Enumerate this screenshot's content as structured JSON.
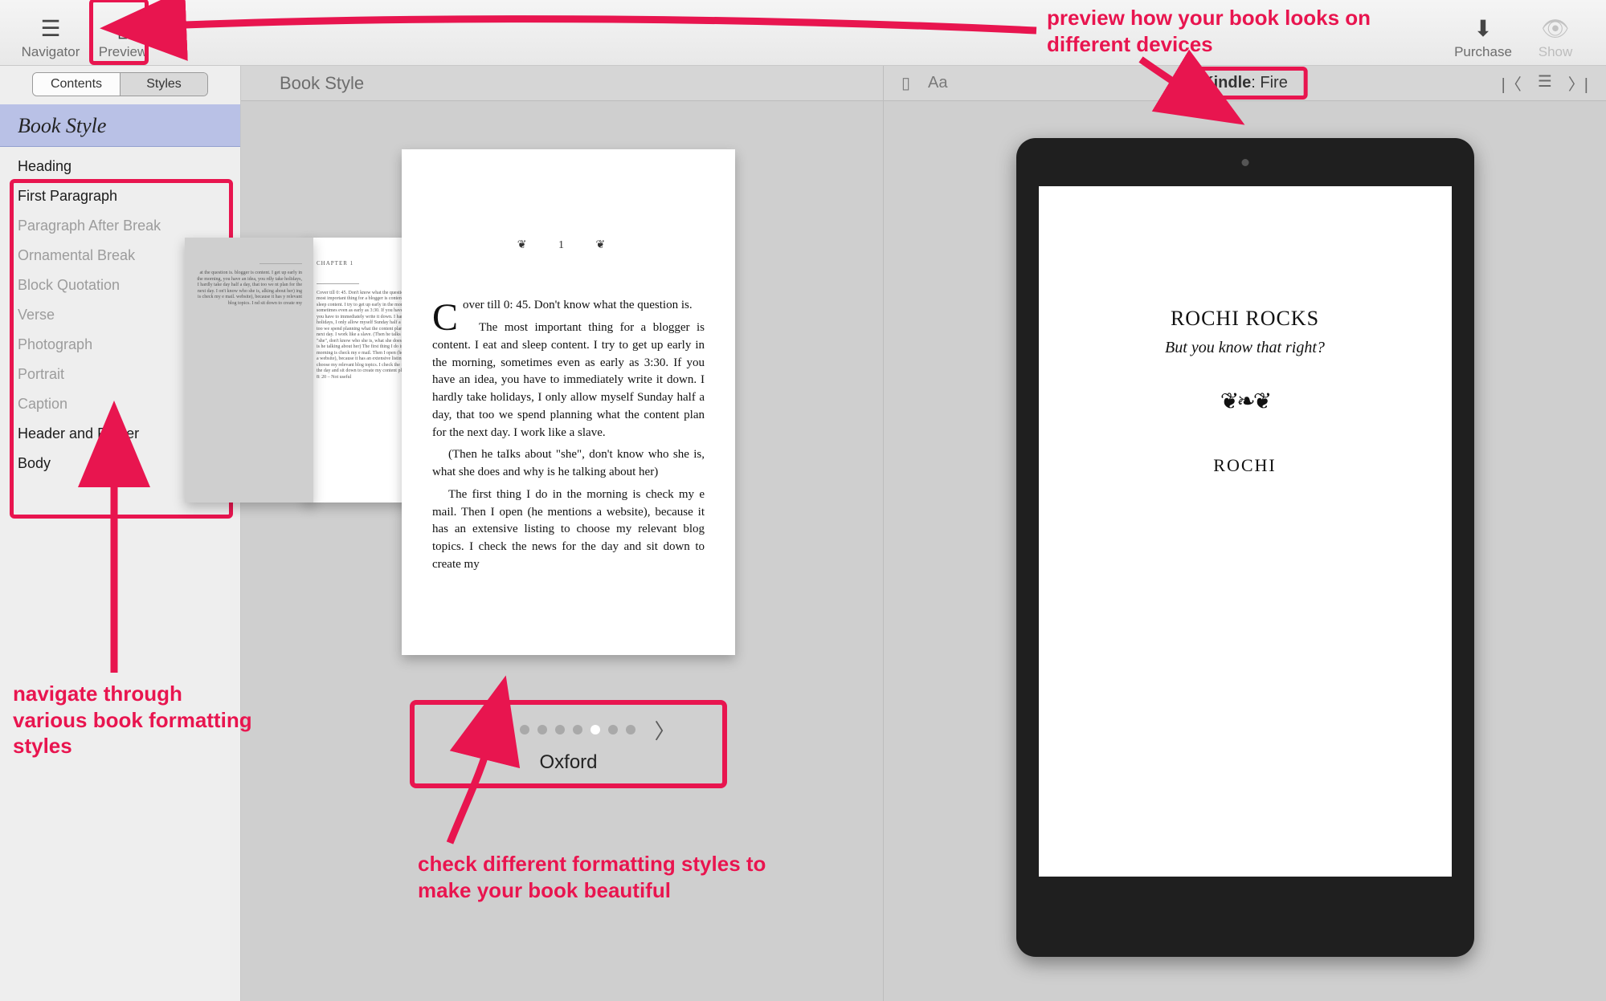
{
  "toolbar": {
    "navigator": "Navigator",
    "preview": "Preview",
    "purchase": "Purchase",
    "show": "Show"
  },
  "sidebar": {
    "tabs": {
      "contents": "Contents",
      "styles": "Styles"
    },
    "heading": "Book Style",
    "items": [
      {
        "label": "Heading",
        "strong": true
      },
      {
        "label": "First Paragraph",
        "strong": true
      },
      {
        "label": "Paragraph After Break",
        "strong": false
      },
      {
        "label": "Ornamental Break",
        "strong": false
      },
      {
        "label": "Block Quotation",
        "strong": false
      },
      {
        "label": "Verse",
        "strong": false
      },
      {
        "label": "Photograph",
        "strong": false
      },
      {
        "label": "Portrait",
        "strong": false
      },
      {
        "label": "Caption",
        "strong": false
      },
      {
        "label": "Header and Footer",
        "strong": true
      },
      {
        "label": "Body",
        "strong": true
      }
    ]
  },
  "center": {
    "title": "Book Style",
    "chapter_marker": "❦   1   ❦",
    "paragraphs": [
      "Cover till 0: 45. Don't know what the question is.",
      "The most important thing for a blogger is content. I eat and sleep content. I try to get up early in the morning, sometimes even as early as 3:30. If you have an idea, you have to immediately write it down. I hardly take holidays, I only allow myself Sunday half a day, that too we spend planning what the content plan for the next day. I work like a slave.",
      "(Then he taIks about \"she\", don't know who she is, what she does and why is he talking about her)",
      "The first thing I do in the morning is check my e mail. Then I open (he mentions a website), because it has an extensive listing to choose my relevant blog topics. I check the news for the day and sit down to create my"
    ],
    "left_page": {
      "label": "CHAPTER 1",
      "text": "Cover till 0: 45. Don't know what the question is. The most important thing for a blogger is content. I eat and sleep content. I try to get up early in the morning, sometimes even as early as 3:30. If you have an idea, you have to immediately write it down. I hardly take holidays, I only allow myself Sunday half a day, that too we spend planning what the content plan for the next day. I work like a slave. (Then he talks about \"she\", don't know who she is, what she does and why is he talking about her) The first thing I do in the morning is check my e mail. Then I open (he mentions a website), because it has an extensive listing to choose my relevant blog topics. I check the news for the day and sit down to create my content plan. 4:00 – 8: 20 – Not useful"
    },
    "right_page": {
      "text": "at the question is. blogger is content. I get up early in the morning, you have an idea, you rdly take holidays, I hardly take day half a day, that too we nt plan for the next day. I on't know who she is, alking about her) ing is check my e mail. website), because it has y relevant blog topics. I nd sit down to create my"
    },
    "style_selector": {
      "name": "Oxford",
      "index": 5,
      "count": 8
    }
  },
  "right": {
    "device_label_prefix": "Kindle",
    "device_label_suffix": ": Fire",
    "book": {
      "title": "ROCHI ROCKS",
      "subtitle": "But you know that right?",
      "ornament": "❦❧❦",
      "author": "ROCHI"
    }
  },
  "annotations": {
    "a1": "preview how your book looks on different devices",
    "a2": "navigate through various book formatting styles",
    "a3": "check different formatting styles to make your book beautiful"
  }
}
